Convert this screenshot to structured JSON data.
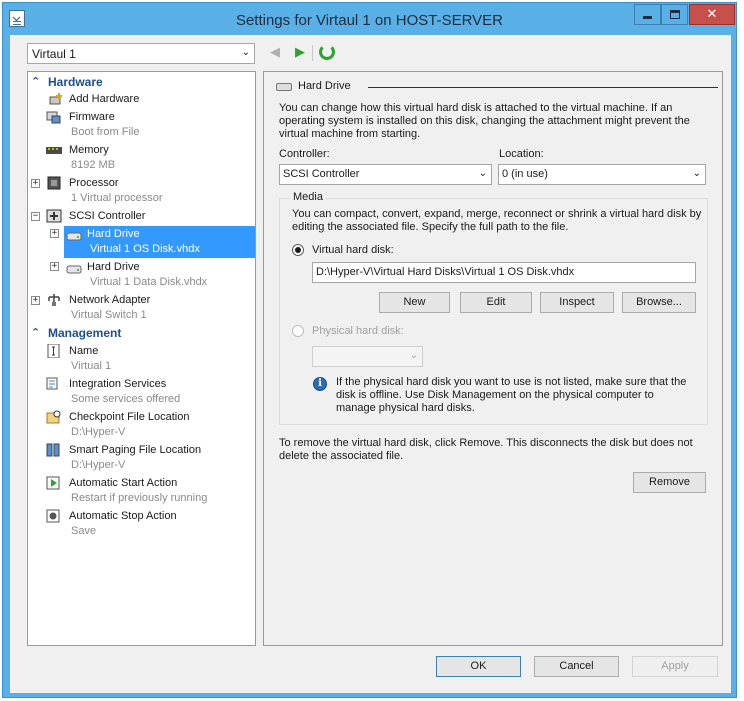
{
  "window": {
    "title": "Settings for Virtaul 1 on HOST-SERVER",
    "close_glyph": "✕"
  },
  "vm_selector": {
    "value": "Virtaul 1",
    "arrow": "⌄"
  },
  "toolbar": {
    "back_glyph": "◀",
    "forward_glyph": "▶"
  },
  "tree": {
    "hardware_label": "Hardware",
    "management_label": "Management",
    "chevron": "⌃",
    "add_hardware": "Add Hardware",
    "firmware": {
      "name": "Firmware",
      "sub": "Boot from File"
    },
    "memory": {
      "name": "Memory",
      "sub": "8192 MB"
    },
    "processor": {
      "name": "Processor",
      "sub": "1 Virtual processor"
    },
    "scsi": {
      "name": "SCSI Controller"
    },
    "hard_drive_1": {
      "name": "Hard Drive",
      "sub": "Virtual 1 OS Disk.vhdx"
    },
    "hard_drive_2": {
      "name": "Hard Drive",
      "sub": "Virtual 1 Data Disk.vhdx"
    },
    "network": {
      "name": "Network Adapter",
      "sub": "Virtual Switch 1"
    },
    "name_item": {
      "name": "Name",
      "sub": "Virtual 1"
    },
    "integration": {
      "name": "Integration Services",
      "sub": "Some services offered"
    },
    "checkpoint": {
      "name": "Checkpoint File Location",
      "sub": "D:\\Hyper-V"
    },
    "paging": {
      "name": "Smart Paging File Location",
      "sub": "D:\\Hyper-V"
    },
    "auto_start": {
      "name": "Automatic Start Action",
      "sub": "Restart if previously running"
    },
    "auto_stop": {
      "name": "Automatic Stop Action",
      "sub": "Save"
    },
    "plus": "+",
    "minus": "−"
  },
  "panel": {
    "section_title": "Hard Drive",
    "intro": "You can change how this virtual hard disk is attached to the virtual machine. If an operating system is installed on this disk, changing the attachment might prevent the virtual machine from starting.",
    "controller_label": "Controller:",
    "controller_value": "SCSI Controller",
    "location_label": "Location:",
    "location_value": "0 (in use)",
    "media_legend": "Media",
    "media_desc": "You can compact, convert, expand, merge, reconnect or shrink a virtual hard disk by editing the associated file. Specify the full path to the file.",
    "vhd_label": "Virtual hard disk:",
    "vhd_path": "D:\\Hyper-V\\Virtual Hard Disks\\Virtual 1 OS Disk.vhdx",
    "btn_new": "New",
    "btn_edit": "Edit",
    "btn_inspect": "Inspect",
    "btn_browse": "Browse...",
    "phys_label": "Physical hard disk:",
    "info_glyph": "i",
    "info_text": "If the physical hard disk you want to use is not listed, make sure that the disk is offline. Use Disk Management on the physical computer to manage physical hard disks.",
    "remove_desc": "To remove the virtual hard disk, click Remove. This disconnects the disk but does not delete the associated file.",
    "btn_remove": "Remove"
  },
  "footer": {
    "ok": "OK",
    "cancel": "Cancel",
    "apply": "Apply"
  }
}
